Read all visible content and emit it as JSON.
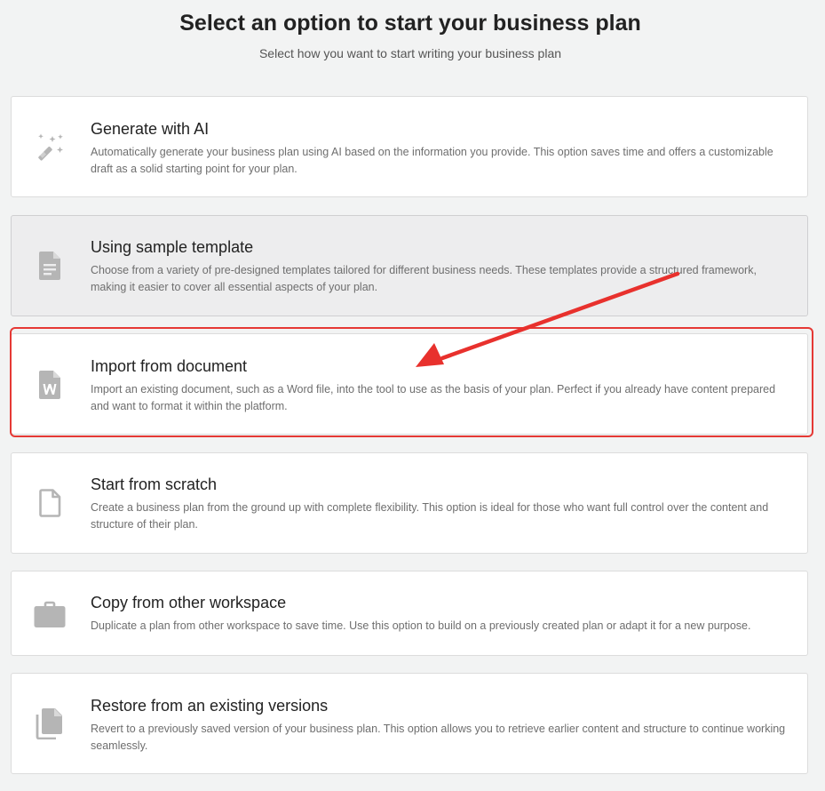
{
  "header": {
    "title": "Select an option to start your business plan",
    "subtitle": "Select how you want to start writing your business plan"
  },
  "options": [
    {
      "icon": "magic-wand-icon",
      "title": "Generate with AI",
      "description": "Automatically generate your business plan using AI based on the information you provide. This option saves time and offers a customizable draft as a solid starting point for your plan."
    },
    {
      "icon": "document-icon",
      "title": "Using sample template",
      "description": "Choose from a variety of pre-designed templates tailored for different business needs. These templates provide a structured framework, making it easier to cover all essential aspects of your plan."
    },
    {
      "icon": "word-file-icon",
      "title": "Import from document",
      "description": "Import an existing document, such as a Word file, into the tool to use as the basis of your plan. Perfect if you already have content prepared and want to format it within the platform."
    },
    {
      "icon": "blank-file-icon",
      "title": "Start from scratch",
      "description": "Create a business plan from the ground up with complete flexibility. This option is ideal for those who want full control over the content and structure of their plan."
    },
    {
      "icon": "briefcase-icon",
      "title": "Copy from other workspace",
      "description": "Duplicate a plan from other workspace to save time. Use this option to build on a previously created plan or adapt it for a new purpose."
    },
    {
      "icon": "copy-files-icon",
      "title": "Restore from an existing versions",
      "description": "Revert to a previously saved version of your business plan. This option allows you to retrieve earlier content and structure to continue working seamlessly."
    }
  ],
  "hovered_option": "Using sample template",
  "annotation": {
    "highlighted_option": "Import from document",
    "highlight_color": "#e53935",
    "arrow_color": "#e8312d"
  },
  "colors": {
    "background": "#f2f3f3",
    "card_background": "#ffffff",
    "card_hover_background": "#ededee",
    "icon_color": "#b5b5b5",
    "title_color": "#222222",
    "description_color": "#6e6e6e"
  }
}
